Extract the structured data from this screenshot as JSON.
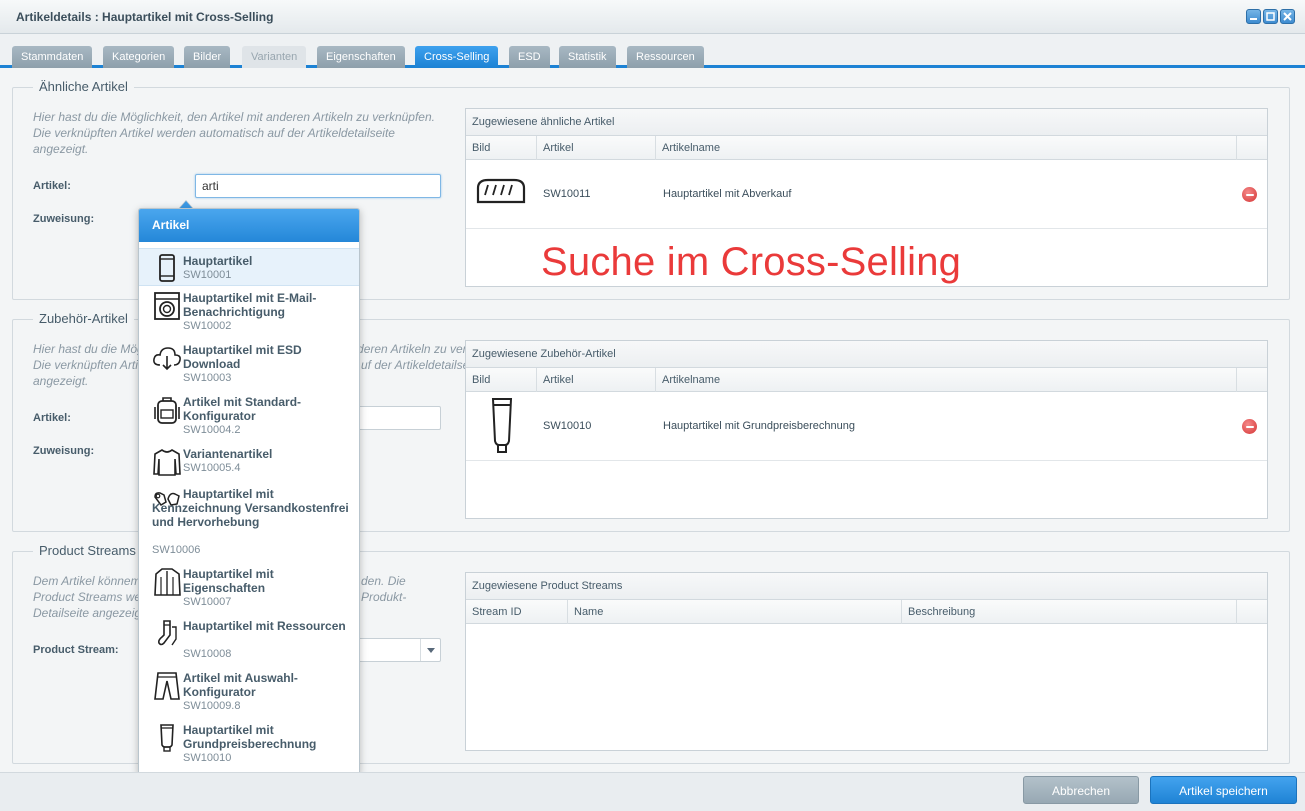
{
  "window": {
    "title": "Artikeldetails : Hauptartikel mit Cross-Selling",
    "controls": [
      "minimize-icon",
      "maximize-icon",
      "close-icon"
    ]
  },
  "tabs": [
    {
      "label": "Stammdaten",
      "state": "normal"
    },
    {
      "label": "Kategorien",
      "state": "normal"
    },
    {
      "label": "Bilder",
      "state": "normal"
    },
    {
      "label": "Varianten",
      "state": "disabled"
    },
    {
      "label": "Eigenschaften",
      "state": "normal"
    },
    {
      "label": "Cross-Selling",
      "state": "active"
    },
    {
      "label": "ESD",
      "state": "normal"
    },
    {
      "label": "Statistik",
      "state": "normal"
    },
    {
      "label": "Ressourcen",
      "state": "normal"
    }
  ],
  "similar": {
    "legend": "Ähnliche Artikel",
    "description": "Hier hast du die Möglichkeit, den Artikel mit anderen Artikeln zu verknüpfen. Die verknüpften Artikel werden automatisch auf der Artikeldetailseite angezeigt.",
    "artikel_label": "Artikel:",
    "artikel_value": "arti",
    "zuweisung_label": "Zuweisung:",
    "grid": {
      "title": "Zugewiesene ähnliche Artikel",
      "columns": [
        "Bild",
        "Artikel",
        "Artikelname"
      ],
      "rows": [
        {
          "icon": "bread-icon",
          "artikel": "SW10011",
          "name": "Hauptartikel mit Abverkauf"
        }
      ]
    }
  },
  "accessory": {
    "legend": "Zubehör-Artikel",
    "description_visible": [
      "Hier hast du die Mög",
      "Die verknüpften Arti",
      "angezeigt.",
      "t anderen Artikeln zu verknüpfen.",
      "uf der Artikeldetailseite"
    ],
    "artikel_label": "Artikel:",
    "zuweisung_label": "Zuweisung:",
    "grid": {
      "title": "Zugewiesene Zubehör-Artikel",
      "columns": [
        "Bild",
        "Artikel",
        "Artikelname"
      ],
      "rows": [
        {
          "icon": "tube-icon",
          "artikel": "SW10010",
          "name": "Hauptartikel mit Grundpreisberechnung"
        }
      ]
    }
  },
  "streams": {
    "legend": "Product Streams",
    "description_visible": [
      "Dem Artikel könnem",
      "Product Streams we",
      "Detailseite angezeig",
      "den. Die",
      "Produkt-"
    ],
    "stream_label": "Product Stream:",
    "grid": {
      "title": "Zugewiesene Product Streams",
      "columns": [
        "Stream ID",
        "Name",
        "Beschreibung"
      ]
    }
  },
  "overlay": {
    "text": "Suche im Cross-Selling"
  },
  "dropdown": {
    "header": "Artikel",
    "items": [
      {
        "icon": "smartphone-icon",
        "name": "Hauptartikel",
        "number": "SW10001",
        "highlight": true
      },
      {
        "icon": "washing-machine-icon",
        "name": "Hauptartikel mit E-Mail-Benachrichtigung",
        "number": "SW10002"
      },
      {
        "icon": "cloud-download-icon",
        "name": "Hauptartikel mit ESD Download",
        "number": "SW10003"
      },
      {
        "icon": "backpack-icon",
        "name": "Artikel mit Standard-Konfigurator",
        "number": "SW10004.2"
      },
      {
        "icon": "sweater-icon",
        "name": "Variantenartikel",
        "number": "SW10005.4"
      },
      {
        "icon": "mittens-icon",
        "name": "Hauptartikel mit Kennzeichnung Versandkostenfrei und Hervorhebung",
        "number": "SW10006"
      },
      {
        "icon": "jacket-icon",
        "name": "Hauptartikel mit Eigenschaften",
        "number": "SW10007"
      },
      {
        "icon": "socks-icon",
        "name": "Hauptartikel mit Ressourcen",
        "number": "SW10008"
      },
      {
        "icon": "trousers-icon",
        "name": "Artikel mit Auswahl-Konfigurator",
        "number": "SW10009.8"
      },
      {
        "icon": "tube-icon",
        "name": "Hauptartikel mit Grundpreisberechnung",
        "number": "SW10010"
      }
    ]
  },
  "footer": {
    "cancel_label": "Abbrechen",
    "save_label": "Artikel speichern"
  },
  "colors": {
    "accent": "#1c82d4",
    "overlay_red": "#ea3a3a"
  }
}
